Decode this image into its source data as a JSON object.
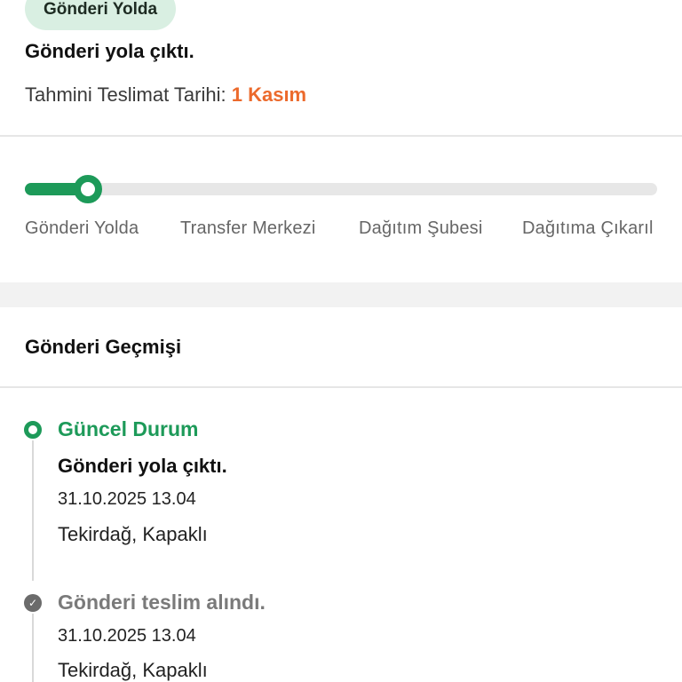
{
  "header": {
    "badge": "Gönderi Yolda",
    "status_title": "Gönderi yola çıktı.",
    "eta_label": "Tahmini Teslimat Tarihi:",
    "eta_date": "1 Kasım"
  },
  "progress": {
    "fraction": 0.1,
    "steps": [
      "Gönderi Yolda",
      "Transfer Merkezi",
      "Dağıtım Şubesi",
      "Dağıtıma Çıkarıl"
    ]
  },
  "history": {
    "title": "Gönderi Geçmişi",
    "events": [
      {
        "label": "Güncel Durum",
        "title": "Gönderi yola çıktı.",
        "datetime": "31.10.2025 13.04",
        "location": "Tekirdağ, Kapaklı"
      },
      {
        "label": "Gönderi teslim alındı.",
        "datetime": "31.10.2025 13.04",
        "location": "Tekirdağ, Kapaklı"
      }
    ]
  },
  "colors": {
    "accent_green": "#1d9a59",
    "badge_bg": "#d9efe2",
    "eta_orange": "#ec6a2c"
  },
  "icons": {
    "current": "current-status-ring-icon",
    "done": "check-circle-icon"
  }
}
